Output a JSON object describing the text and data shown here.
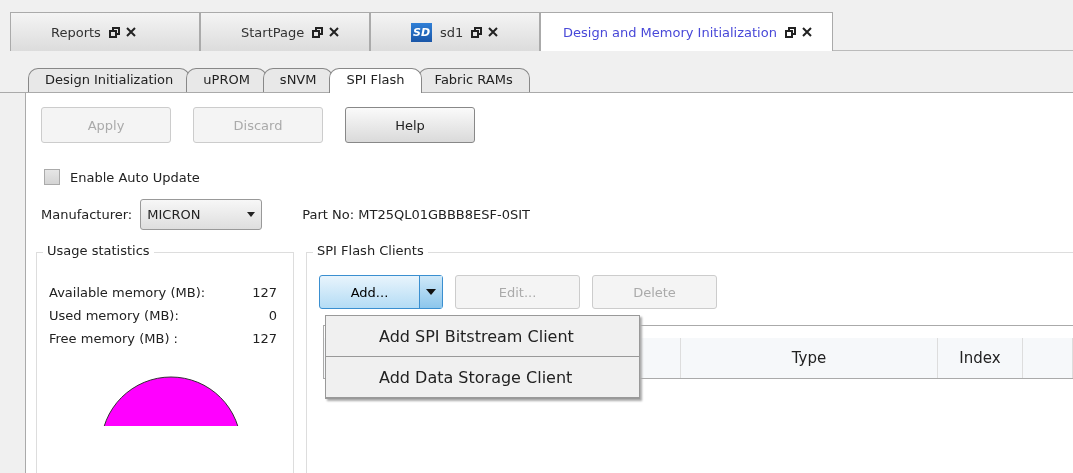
{
  "doc_tabs": [
    {
      "label": "Reports",
      "selected": false
    },
    {
      "label": "StartPage",
      "selected": false
    },
    {
      "label": "sd1",
      "badge": "SD",
      "selected": false
    },
    {
      "label": "Design and Memory Initialization",
      "selected": true
    }
  ],
  "inner_tabs": [
    {
      "label": "Design Initialization",
      "selected": false
    },
    {
      "label": "uPROM",
      "selected": false
    },
    {
      "label": "sNVM",
      "selected": false
    },
    {
      "label": "SPI Flash",
      "selected": true
    },
    {
      "label": "Fabric RAMs",
      "selected": false
    }
  ],
  "toolbar": [
    {
      "label": "Apply",
      "disabled": true
    },
    {
      "label": "Discard",
      "disabled": true
    },
    {
      "label": "Help",
      "disabled": false
    }
  ],
  "auto_update": {
    "label": "Enable Auto Update",
    "checked": false
  },
  "manufacturer": {
    "label": "Manufacturer:",
    "value": "MICRON"
  },
  "part_no": "Part No: MT25QL01GBBB8ESF-0SIT",
  "usage": {
    "title": "Usage statistics",
    "rows": [
      {
        "label": "Available memory (MB):",
        "value": "127"
      },
      {
        "label": "Used memory (MB):",
        "value": "0"
      },
      {
        "label": "Free memory (MB) :",
        "value": "127"
      }
    ]
  },
  "clients": {
    "title": "SPI Flash Clients",
    "buttons": [
      {
        "kind": "split",
        "label": "Add...",
        "disabled": false
      },
      {
        "kind": "plain",
        "label": "Edit...",
        "disabled": true
      },
      {
        "kind": "plain",
        "label": "Delete",
        "disabled": true
      }
    ],
    "menu": [
      "Add SPI Bitstream Client",
      "Add  Data Storage Client"
    ],
    "table": {
      "columns": [
        "Type",
        "Index"
      ]
    }
  }
}
